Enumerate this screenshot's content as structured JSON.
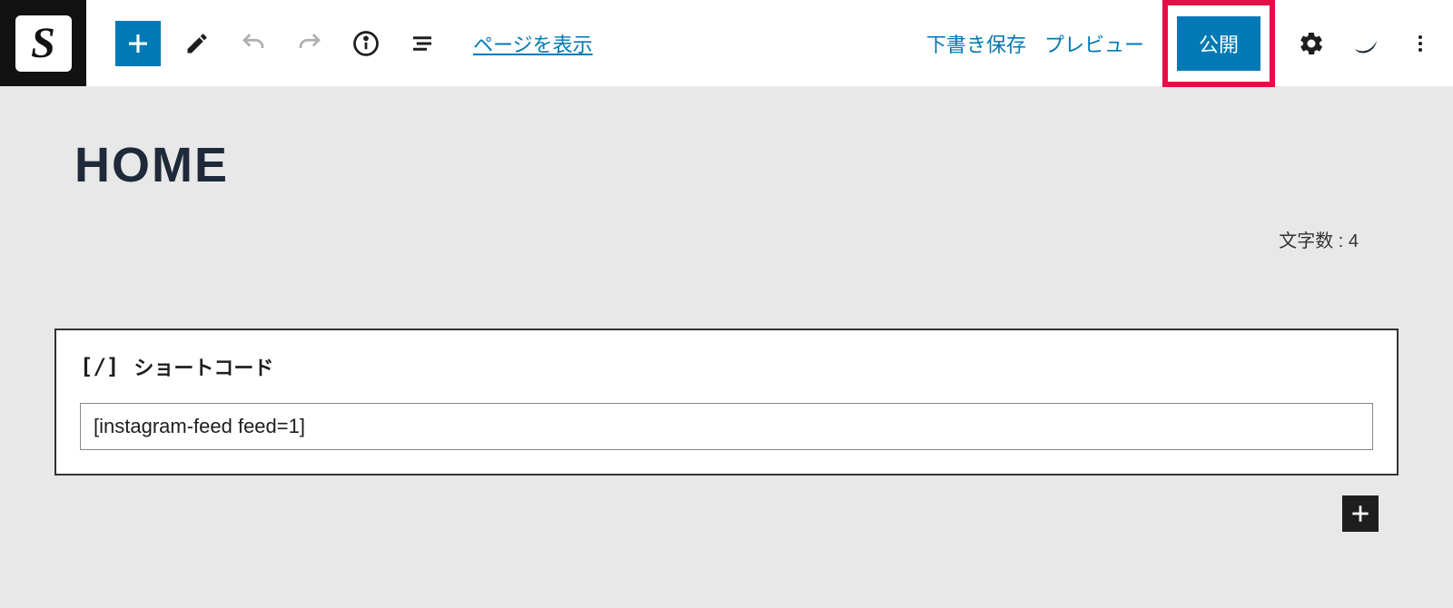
{
  "toolbar": {
    "logo_letter": "S",
    "view_page_link": "ページを表示",
    "save_draft": "下書き保存",
    "preview": "プレビュー",
    "publish": "公開"
  },
  "editor": {
    "title": "HOME",
    "char_count_label": "文字数 : 4"
  },
  "shortcode_block": {
    "icon_text": "[/]",
    "label": "ショートコード",
    "value": "[instagram-feed feed=1]"
  },
  "colors": {
    "primary": "#0179b4",
    "highlight": "#e30e48",
    "dark": "#1e2a3a"
  }
}
